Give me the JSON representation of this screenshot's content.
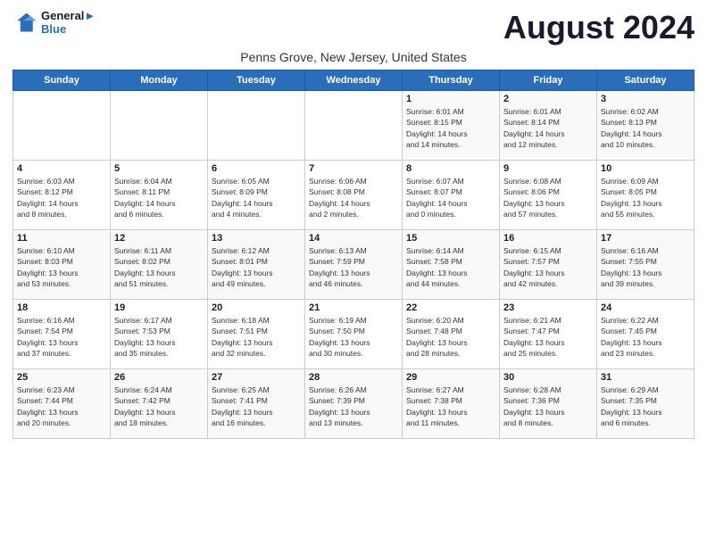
{
  "header": {
    "logo_line1": "General",
    "logo_line2": "Blue",
    "month_title": "August 2024",
    "location": "Penns Grove, New Jersey, United States"
  },
  "days_of_week": [
    "Sunday",
    "Monday",
    "Tuesday",
    "Wednesday",
    "Thursday",
    "Friday",
    "Saturday"
  ],
  "weeks": [
    [
      {
        "num": "",
        "text": ""
      },
      {
        "num": "",
        "text": ""
      },
      {
        "num": "",
        "text": ""
      },
      {
        "num": "",
        "text": ""
      },
      {
        "num": "1",
        "text": "Sunrise: 6:01 AM\nSunset: 8:15 PM\nDaylight: 14 hours\nand 14 minutes."
      },
      {
        "num": "2",
        "text": "Sunrise: 6:01 AM\nSunset: 8:14 PM\nDaylight: 14 hours\nand 12 minutes."
      },
      {
        "num": "3",
        "text": "Sunrise: 6:02 AM\nSunset: 8:13 PM\nDaylight: 14 hours\nand 10 minutes."
      }
    ],
    [
      {
        "num": "4",
        "text": "Sunrise: 6:03 AM\nSunset: 8:12 PM\nDaylight: 14 hours\nand 8 minutes."
      },
      {
        "num": "5",
        "text": "Sunrise: 6:04 AM\nSunset: 8:11 PM\nDaylight: 14 hours\nand 6 minutes."
      },
      {
        "num": "6",
        "text": "Sunrise: 6:05 AM\nSunset: 8:09 PM\nDaylight: 14 hours\nand 4 minutes."
      },
      {
        "num": "7",
        "text": "Sunrise: 6:06 AM\nSunset: 8:08 PM\nDaylight: 14 hours\nand 2 minutes."
      },
      {
        "num": "8",
        "text": "Sunrise: 6:07 AM\nSunset: 8:07 PM\nDaylight: 14 hours\nand 0 minutes."
      },
      {
        "num": "9",
        "text": "Sunrise: 6:08 AM\nSunset: 8:06 PM\nDaylight: 13 hours\nand 57 minutes."
      },
      {
        "num": "10",
        "text": "Sunrise: 6:09 AM\nSunset: 8:05 PM\nDaylight: 13 hours\nand 55 minutes."
      }
    ],
    [
      {
        "num": "11",
        "text": "Sunrise: 6:10 AM\nSunset: 8:03 PM\nDaylight: 13 hours\nand 53 minutes."
      },
      {
        "num": "12",
        "text": "Sunrise: 6:11 AM\nSunset: 8:02 PM\nDaylight: 13 hours\nand 51 minutes."
      },
      {
        "num": "13",
        "text": "Sunrise: 6:12 AM\nSunset: 8:01 PM\nDaylight: 13 hours\nand 49 minutes."
      },
      {
        "num": "14",
        "text": "Sunrise: 6:13 AM\nSunset: 7:59 PM\nDaylight: 13 hours\nand 46 minutes."
      },
      {
        "num": "15",
        "text": "Sunrise: 6:14 AM\nSunset: 7:58 PM\nDaylight: 13 hours\nand 44 minutes."
      },
      {
        "num": "16",
        "text": "Sunrise: 6:15 AM\nSunset: 7:57 PM\nDaylight: 13 hours\nand 42 minutes."
      },
      {
        "num": "17",
        "text": "Sunrise: 6:16 AM\nSunset: 7:55 PM\nDaylight: 13 hours\nand 39 minutes."
      }
    ],
    [
      {
        "num": "18",
        "text": "Sunrise: 6:16 AM\nSunset: 7:54 PM\nDaylight: 13 hours\nand 37 minutes."
      },
      {
        "num": "19",
        "text": "Sunrise: 6:17 AM\nSunset: 7:53 PM\nDaylight: 13 hours\nand 35 minutes."
      },
      {
        "num": "20",
        "text": "Sunrise: 6:18 AM\nSunset: 7:51 PM\nDaylight: 13 hours\nand 32 minutes."
      },
      {
        "num": "21",
        "text": "Sunrise: 6:19 AM\nSunset: 7:50 PM\nDaylight: 13 hours\nand 30 minutes."
      },
      {
        "num": "22",
        "text": "Sunrise: 6:20 AM\nSunset: 7:48 PM\nDaylight: 13 hours\nand 28 minutes."
      },
      {
        "num": "23",
        "text": "Sunrise: 6:21 AM\nSunset: 7:47 PM\nDaylight: 13 hours\nand 25 minutes."
      },
      {
        "num": "24",
        "text": "Sunrise: 6:22 AM\nSunset: 7:45 PM\nDaylight: 13 hours\nand 23 minutes."
      }
    ],
    [
      {
        "num": "25",
        "text": "Sunrise: 6:23 AM\nSunset: 7:44 PM\nDaylight: 13 hours\nand 20 minutes."
      },
      {
        "num": "26",
        "text": "Sunrise: 6:24 AM\nSunset: 7:42 PM\nDaylight: 13 hours\nand 18 minutes."
      },
      {
        "num": "27",
        "text": "Sunrise: 6:25 AM\nSunset: 7:41 PM\nDaylight: 13 hours\nand 16 minutes."
      },
      {
        "num": "28",
        "text": "Sunrise: 6:26 AM\nSunset: 7:39 PM\nDaylight: 13 hours\nand 13 minutes."
      },
      {
        "num": "29",
        "text": "Sunrise: 6:27 AM\nSunset: 7:38 PM\nDaylight: 13 hours\nand 11 minutes."
      },
      {
        "num": "30",
        "text": "Sunrise: 6:28 AM\nSunset: 7:36 PM\nDaylight: 13 hours\nand 8 minutes."
      },
      {
        "num": "31",
        "text": "Sunrise: 6:29 AM\nSunset: 7:35 PM\nDaylight: 13 hours\nand 6 minutes."
      }
    ]
  ]
}
